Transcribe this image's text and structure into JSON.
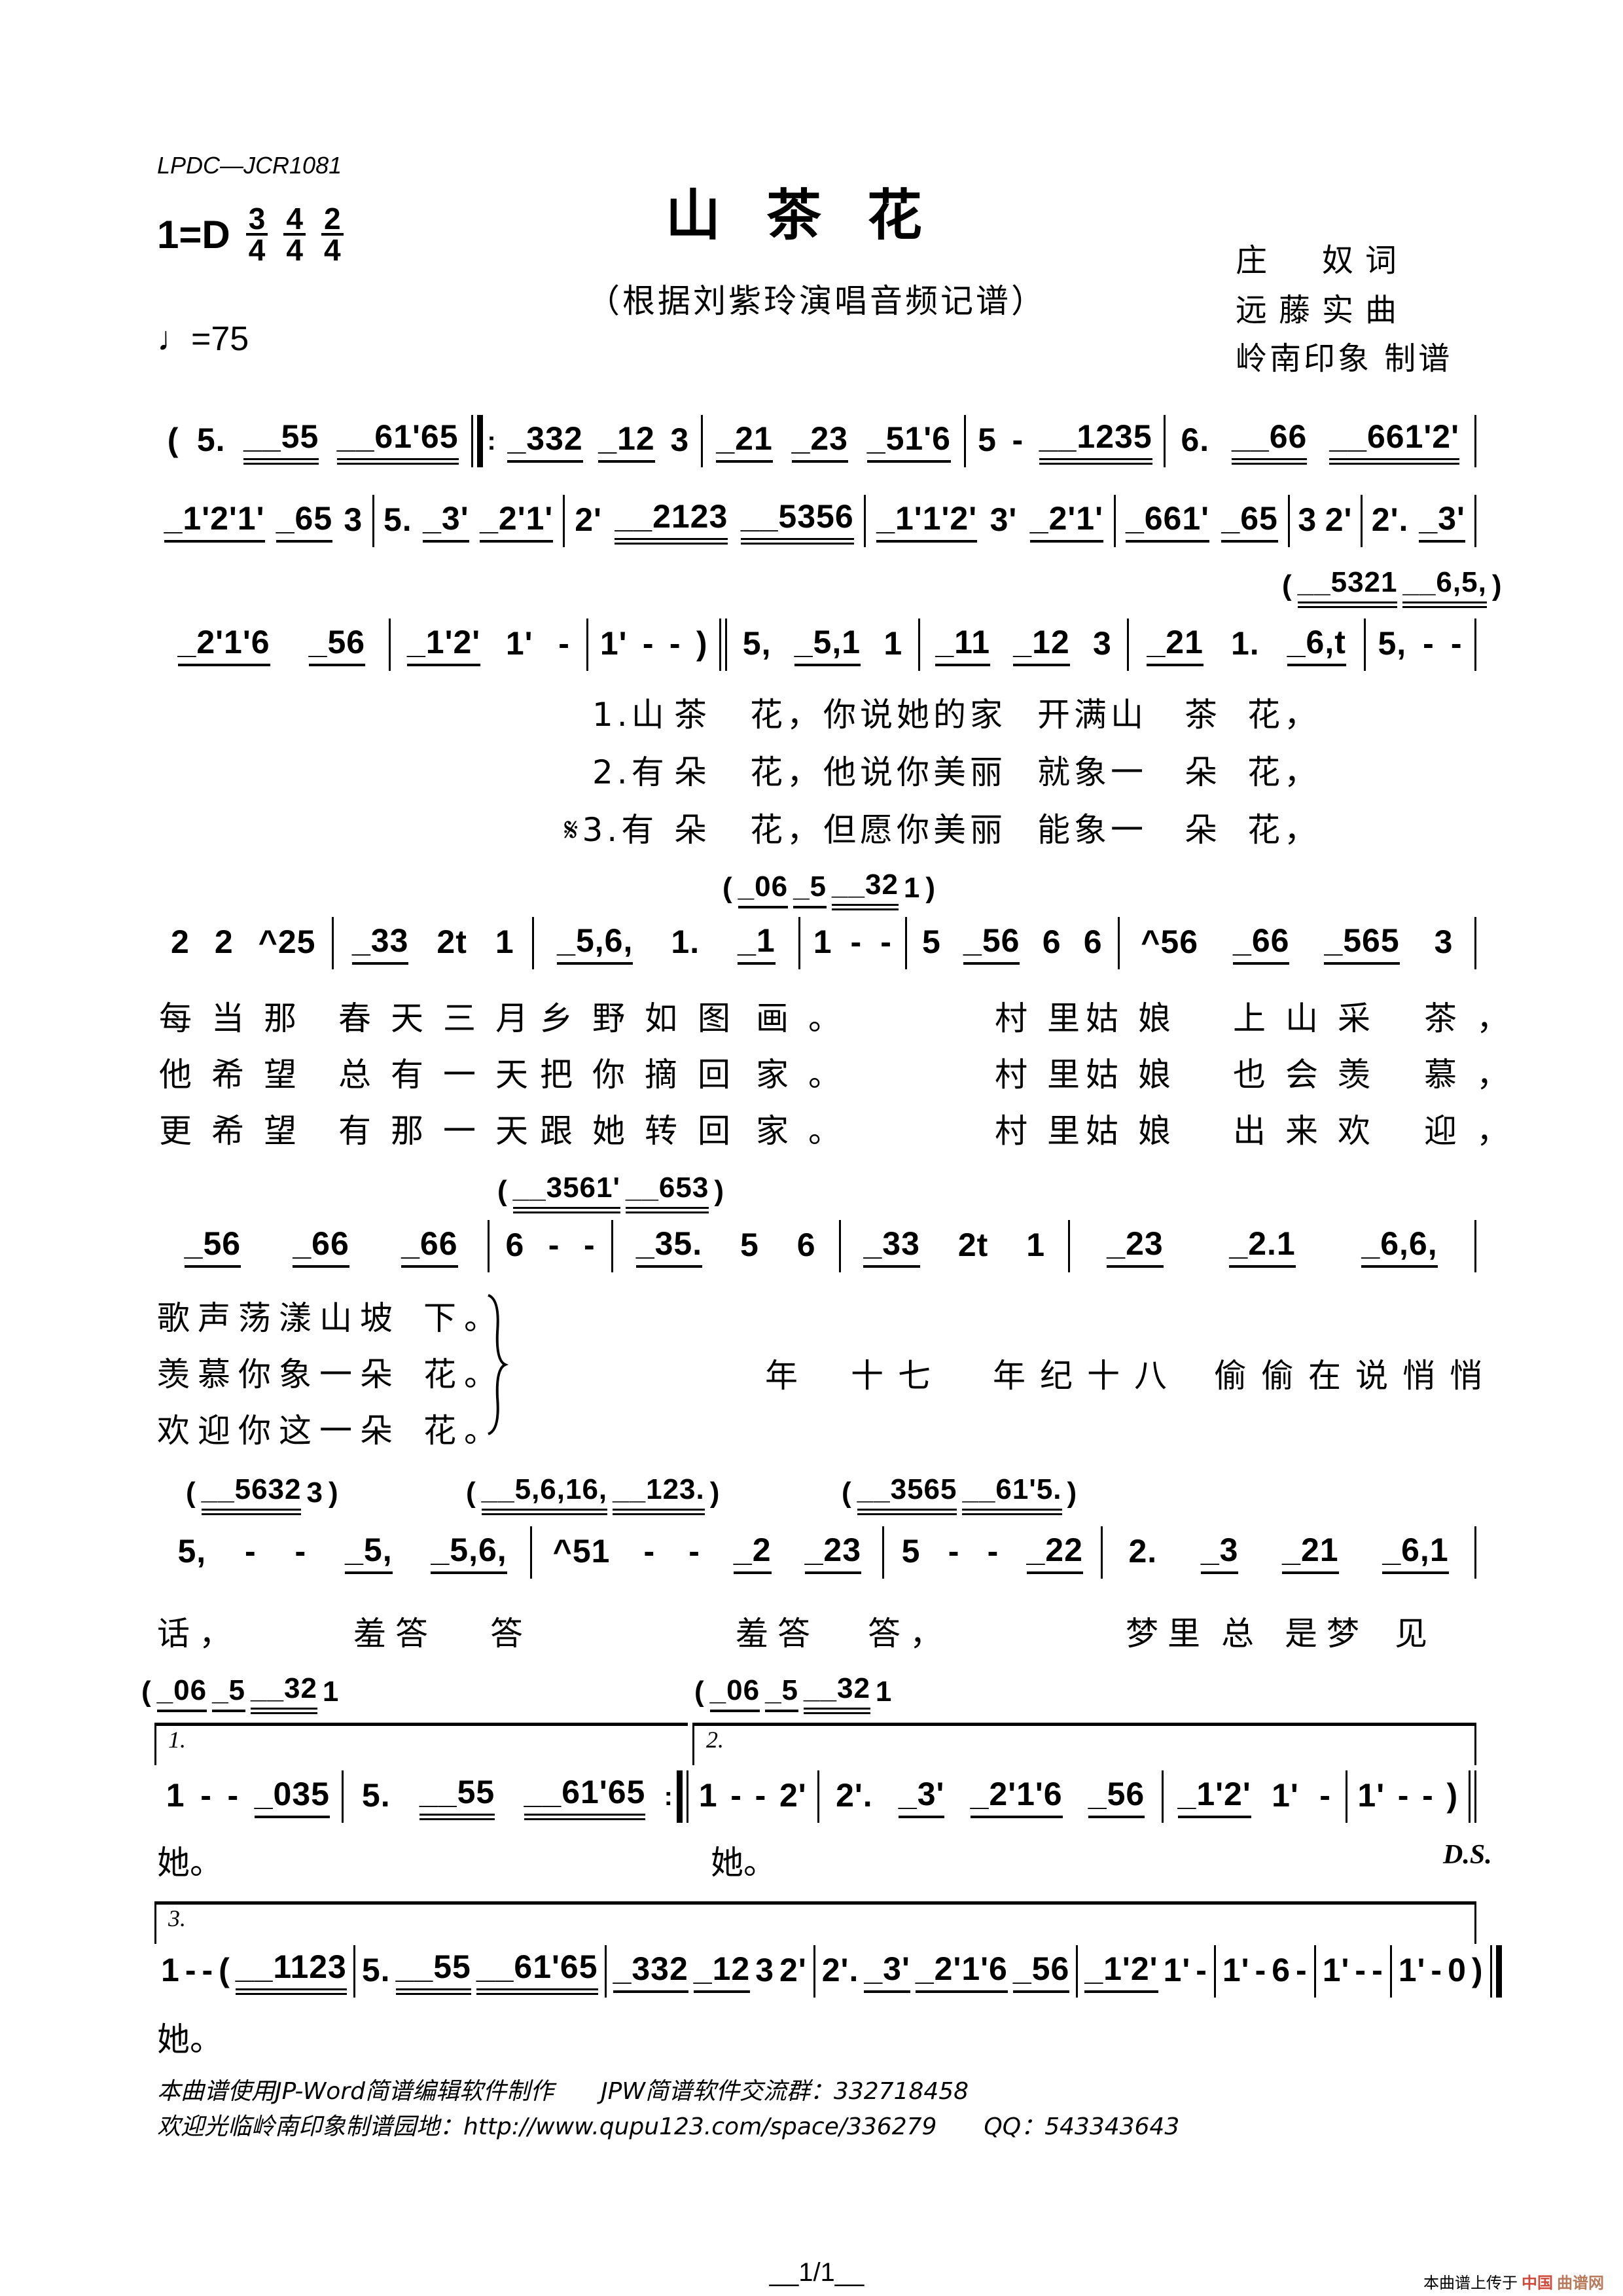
{
  "header": {
    "code": "LPDC—JCR1081",
    "title": "山茶花",
    "subtitle": "（根据刘紫玲演唱音频记谱）",
    "key": "1=D",
    "time_signatures": [
      {
        "num": "3",
        "den": "4"
      },
      {
        "num": "4",
        "den": "4"
      },
      {
        "num": "2",
        "den": "4"
      }
    ],
    "tempo": "♩=75",
    "credits": [
      "庄　奴词",
      "远藤实曲",
      "岭南印象 制谱"
    ]
  },
  "score": {
    "lines": [
      {
        "measures": [
          {
            "notes": [
              "(",
              "5.",
              "__55",
              "__61'65"
            ],
            "bar": "|:"
          },
          {
            "notes": [
              "_332",
              "_12",
              "3"
            ],
            "bar": "|"
          },
          {
            "notes": [
              "_21",
              "_23",
              "_51'6"
            ],
            "bar": "|"
          },
          {
            "notes": [
              "5",
              "-",
              "__1235"
            ],
            "bar": "|"
          },
          {
            "notes": [
              "6.",
              "__66",
              "__661'2'"
            ],
            "bar": "|"
          }
        ]
      },
      {
        "measures": [
          {
            "notes": [
              "_1'2'1'",
              "_65",
              "3"
            ],
            "bar": "|"
          },
          {
            "notes": [
              "5.",
              "_3'",
              "_2'1'"
            ],
            "bar": "|"
          },
          {
            "notes": [
              "2'",
              "__2123",
              "__5356"
            ],
            "bar": "|"
          },
          {
            "notes": [
              "_1'1'2'",
              "3'",
              "_2'1'"
            ],
            "bar": "|"
          },
          {
            "notes": [
              "_661'",
              "_65"
            ],
            "bar": "|"
          },
          {
            "notes": [
              "3",
              "2'"
            ],
            "bar": "|"
          },
          {
            "notes": [
              "2'.",
              "_3'"
            ],
            "bar": "|"
          }
        ]
      },
      {
        "measures": [
          {
            "notes": [
              "_2'1'6",
              "_56"
            ],
            "bar": "|"
          },
          {
            "notes": [
              "_1'2'",
              "1'",
              "-"
            ],
            "bar": "|"
          },
          {
            "notes": [
              "1'",
              "-",
              "-",
              ")"
            ],
            "bar": "||"
          },
          {
            "notes": [
              "5,",
              "_5,1",
              "1"
            ],
            "bar": "|"
          },
          {
            "notes": [
              "_11",
              "_12",
              "3"
            ],
            "bar": "|"
          },
          {
            "notes": [
              "_21",
              "1.",
              "_6,t"
            ],
            "bar": "|"
          },
          {
            "notes": [
              "5,",
              "-",
              "-"
            ],
            "bar": "|"
          }
        ]
      },
      {
        "measures": [
          {
            "notes": [
              "2",
              "2",
              "^25"
            ],
            "bar": "|"
          },
          {
            "notes": [
              "_33",
              "2t",
              "1"
            ],
            "bar": "|"
          },
          {
            "notes": [
              "_5,6,",
              "1.",
              "_1"
            ],
            "bar": "|"
          },
          {
            "notes": [
              "1",
              "-",
              "-"
            ],
            "bar": "|"
          },
          {
            "notes": [
              "5",
              "_56",
              "6",
              "6"
            ],
            "bar": "|"
          },
          {
            "notes": [
              "^56",
              "_66",
              "_565",
              "3"
            ],
            "bar": "|"
          }
        ]
      },
      {
        "measures": [
          {
            "notes": [
              "_56",
              "_66",
              "_66"
            ],
            "bar": "|"
          },
          {
            "notes": [
              "6",
              "-",
              "-"
            ],
            "bar": "|"
          },
          {
            "notes": [
              "_35.",
              "5",
              "6"
            ],
            "bar": "|"
          },
          {
            "notes": [
              "_33",
              "2t",
              "1"
            ],
            "bar": "|"
          },
          {
            "notes": [
              "_23",
              "_2.1",
              "_6,6,"
            ],
            "bar": "|"
          }
        ]
      },
      {
        "measures": [
          {
            "notes": [
              "5,",
              "-",
              "-",
              "_5,",
              "_5,6,"
            ],
            "bar": "|"
          },
          {
            "notes": [
              "^51",
              "-",
              "-",
              "_2",
              "_23"
            ],
            "bar": "|"
          },
          {
            "notes": [
              "5",
              "-",
              "-",
              "_22"
            ],
            "bar": "|"
          },
          {
            "notes": [
              "2.",
              "_3",
              "_21",
              "_6,1"
            ],
            "bar": "|"
          }
        ]
      },
      {
        "measures": [
          {
            "notes": [
              "1",
              "-",
              "-",
              "_035"
            ],
            "bar": "|"
          },
          {
            "notes": [
              "5.",
              "__55",
              "__61'65"
            ],
            "bar": ":|"
          },
          {
            "notes": [
              "1",
              "-",
              "-",
              "2'"
            ],
            "bar": "|"
          },
          {
            "notes": [
              "2'.",
              "_3'",
              "_2'1'6",
              "_56"
            ],
            "bar": "|"
          },
          {
            "notes": [
              "_1'2'",
              "1'",
              "-"
            ],
            "bar": "|"
          },
          {
            "notes": [
              "1'",
              "-",
              "-",
              ")"
            ],
            "bar": "||"
          }
        ]
      },
      {
        "measures": [
          {
            "notes": [
              "1",
              "-",
              "-",
              "(",
              "__1123"
            ],
            "bar": "|"
          },
          {
            "notes": [
              "5.",
              "__55",
              "__61'65"
            ],
            "bar": "|"
          },
          {
            "notes": [
              "_332",
              "_12",
              "3",
              "2'"
            ],
            "bar": "|"
          },
          {
            "notes": [
              "2'.",
              "_3'",
              "_2'1'6",
              "_56"
            ],
            "bar": "|"
          },
          {
            "notes": [
              "_1'2'",
              "1'",
              "-"
            ],
            "bar": "|"
          },
          {
            "notes": [
              "1'",
              "-",
              "6",
              "-"
            ],
            "bar": "|"
          },
          {
            "notes": [
              "1'",
              "-",
              "-"
            ],
            "bar": "|"
          },
          {
            "notes": [
              "1'",
              "-",
              "0",
              ")"
            ],
            "bar": "|]"
          }
        ]
      }
    ],
    "interludes": [
      [
        "(",
        "__5321",
        "__6,5,",
        ")"
      ],
      [
        "(",
        "_06",
        "_5",
        "__32",
        "1",
        ")"
      ],
      [
        "(",
        "__3561'",
        "__653",
        ")"
      ],
      [
        "(",
        "__5632",
        "3",
        ")"
      ],
      [
        "(",
        "__5,6,16,",
        "__123.",
        ")"
      ],
      [
        "(",
        "__3565",
        "__61'5.",
        ")"
      ],
      [
        "(",
        "_06",
        "_5",
        "__32",
        "1"
      ],
      [
        "(",
        "_06",
        "_5",
        "__32",
        "1"
      ]
    ],
    "voltas": [
      "1.",
      "2.",
      "3."
    ],
    "ds": "D.S."
  },
  "lyrics": {
    "line3": [
      [
        "1.山",
        "茶",
        "花，你说她的家",
        "开满山",
        "茶",
        "花，"
      ],
      [
        "2.有",
        "朵",
        "花，他说你美丽",
        "就象一",
        "朵",
        "花，"
      ],
      [
        "𝄋3.有",
        "朵",
        "花，但愿你美丽",
        "能象一",
        "朵",
        "花，"
      ]
    ],
    "line4": [
      [
        "每当那",
        "春天三月",
        "乡野如",
        "图",
        "画。",
        "村里",
        "姑娘",
        "上山采",
        "茶，"
      ],
      [
        "他希望",
        "总有一天",
        "把你摘",
        "回",
        "家。",
        "村里",
        "姑娘",
        "也会羡",
        "慕，"
      ],
      [
        "更希望",
        "有那一天",
        "跟她转",
        "回",
        "家。",
        "村里",
        "姑娘",
        "出来欢",
        "迎，"
      ]
    ],
    "line5": [
      [
        "歌声荡漾山坡",
        "下。"
      ],
      [
        "羡慕你象一朵",
        "花。"
      ],
      [
        "欢迎你这一朵",
        "花。"
      ]
    ],
    "line5_chorus": [
      "年",
      "十七",
      "年纪十八",
      "偷偷在说悄悄"
    ],
    "line6": [
      "话，",
      "羞答",
      "答",
      "羞答",
      "答，",
      "梦里",
      "总",
      "是梦",
      "见"
    ],
    "line7": [
      "她。",
      "她。"
    ],
    "line8": [
      "她。"
    ]
  },
  "footer": {
    "line1": "本曲谱使用JP-Word简谱编辑软件制作　　JPW简谱软件交流群：332718458",
    "line2": "欢迎光临岭南印象制谱园地：http://www.qupu123.com/space/336279　　QQ：543343643",
    "page": "__1/1__",
    "watermark_prefix": "本曲谱上传于",
    "watermark_brand": "中国",
    "watermark_brand2": "曲谱网",
    "brand_color": "#d04a3c"
  }
}
